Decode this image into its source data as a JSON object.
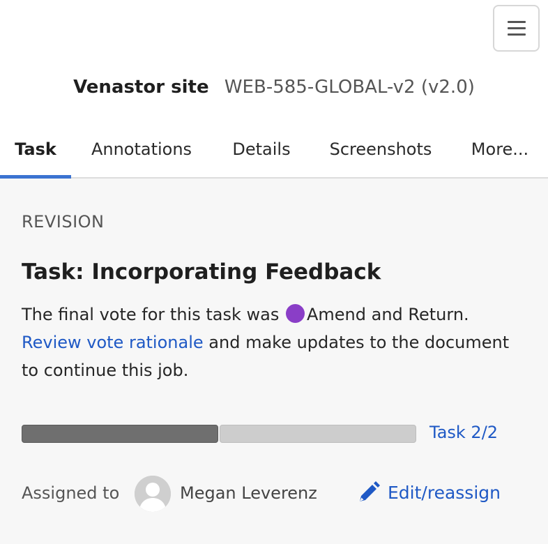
{
  "header": {
    "menu_icon": "hamburger-menu-icon",
    "site_label": "Venastor site",
    "document_id": "WEB-585-GLOBAL-v2 (v2.0)"
  },
  "tabs": [
    {
      "label": "Task",
      "active": true
    },
    {
      "label": "Annotations",
      "active": false
    },
    {
      "label": "Details",
      "active": false
    },
    {
      "label": "Screenshots",
      "active": false
    },
    {
      "label": "More...",
      "active": false
    }
  ],
  "task": {
    "eyebrow": "REVISION",
    "title": "Task: Incorporating Feedback",
    "vote_prefix": "The final vote for this task was",
    "vote_value": "Amend and Return.",
    "vote_color": "#8a3ec7",
    "review_link": "Review vote rationale",
    "desc_suffix": "and make updates to the document to continue this job.",
    "progress": {
      "completed": 1,
      "total": 2
    },
    "task_count": "Task 2/2"
  },
  "assignment": {
    "label": "Assigned to",
    "assignee": "Megan Leverenz",
    "avatar_icon": "user-avatar-icon",
    "edit_icon": "pencil-icon",
    "edit_label": "Edit/reassign"
  },
  "colors": {
    "accent": "#3b73d1",
    "link": "#1f59c5",
    "progress_done": "#6f6f6f",
    "progress_todo": "#cdcdcd",
    "panel_bg": "#f7f7f7"
  }
}
